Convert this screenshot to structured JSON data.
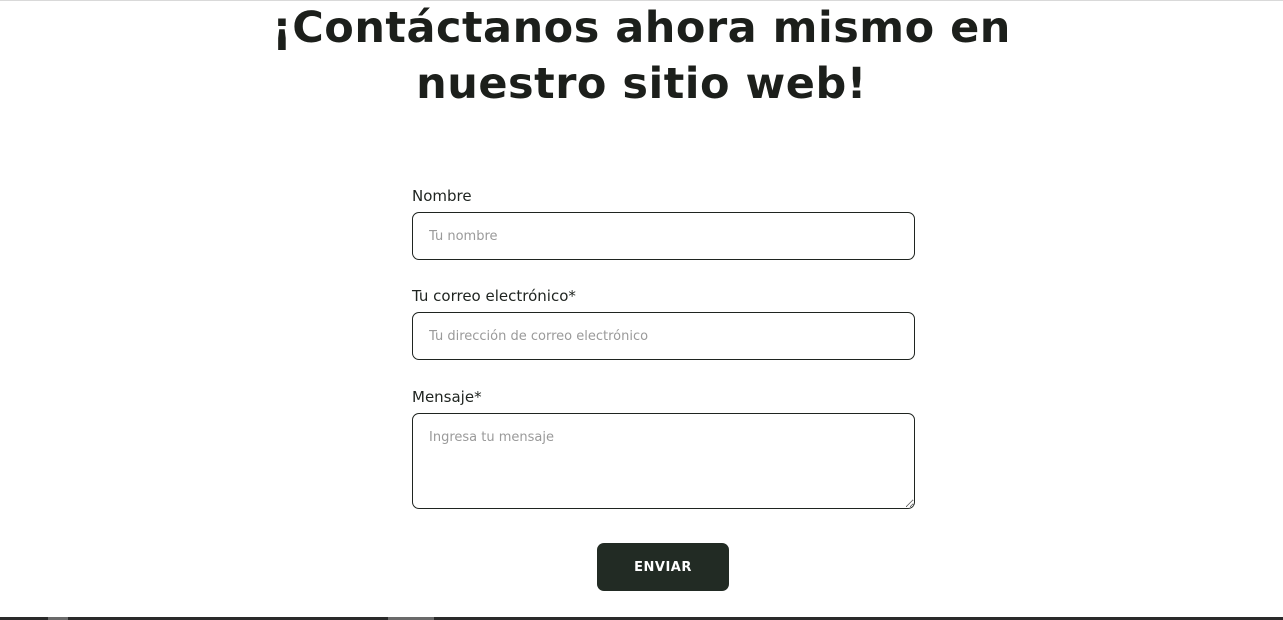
{
  "page": {
    "heading_line1": "¡Contáctanos ahora mismo en",
    "heading_line2": "nuestro sitio web!"
  },
  "form": {
    "name": {
      "label": "Nombre",
      "placeholder": "Tu nombre",
      "value": ""
    },
    "email": {
      "label": "Tu correo electrónico*",
      "placeholder": "Tu dirección de correo electrónico",
      "value": ""
    },
    "message": {
      "label": "Mensaje*",
      "placeholder": "Ingresa tu mensaje",
      "value": ""
    },
    "submit_label": "ENVIAR"
  },
  "colors": {
    "text": "#1f2420",
    "button_bg": "#222b24",
    "button_text": "#ffffff",
    "placeholder": "#9a9a9a",
    "border": "#1f2420"
  }
}
